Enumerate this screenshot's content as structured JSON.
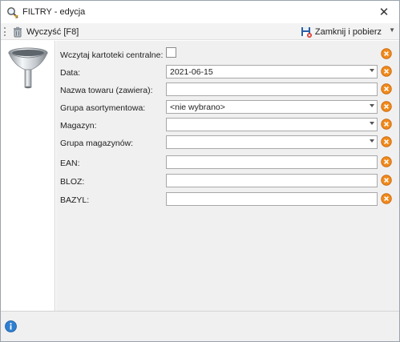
{
  "window": {
    "title": "FILTRY - edycja"
  },
  "toolbar": {
    "clear_label": "Wyczyść [F8]",
    "close_fetch_label": "Zamknij i pobierz"
  },
  "form": {
    "central_files": {
      "label": "Wczytaj kartoteki centralne:",
      "checked": false
    },
    "date": {
      "label": "Data:",
      "value": "2021-06-15"
    },
    "product_name": {
      "label": "Nazwa towaru (zawiera):",
      "value": ""
    },
    "assortment_group": {
      "label": "Grupa asortymentowa:",
      "value": "<nie wybrano>"
    },
    "warehouse": {
      "label": "Magazyn:",
      "value": ""
    },
    "warehouse_group": {
      "label": "Grupa magazynów:",
      "value": ""
    },
    "ean": {
      "label": "EAN:",
      "value": ""
    },
    "bloz": {
      "label": "BLOZ:",
      "value": ""
    },
    "bazyl": {
      "label": "BAZYL:",
      "value": ""
    }
  },
  "colors": {
    "clear_icon": "#f08a1c",
    "info_icon": "#2f7fd1",
    "content_bg": "#f0f0f0"
  }
}
